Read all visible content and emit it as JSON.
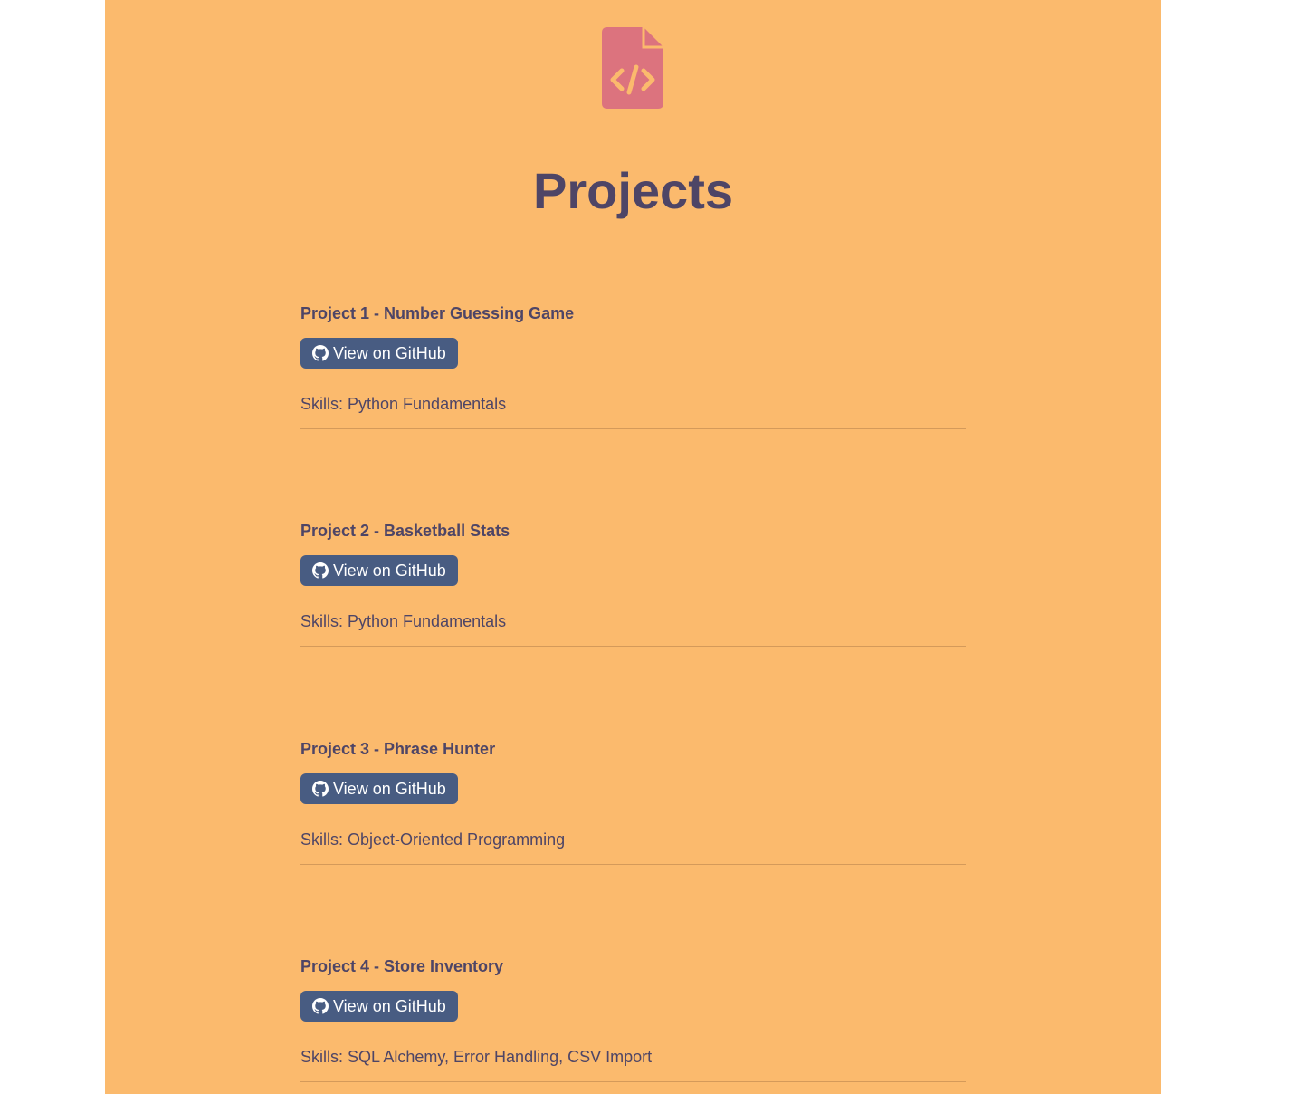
{
  "page": {
    "title": "Projects",
    "logo_icon": "file-code-icon",
    "colors": {
      "background": "#fbba6d",
      "heading": "#4e4566",
      "button": "#485c82",
      "logo": "#dc737e"
    }
  },
  "projects": [
    {
      "title": "Project 1 - Number Guessing Game",
      "button_label": "View on GitHub",
      "button_icon": "github-icon",
      "skills": "Skills: Python Fundamentals"
    },
    {
      "title": "Project 2 - Basketball Stats",
      "button_label": "View on GitHub",
      "button_icon": "github-icon",
      "skills": "Skills: Python Fundamentals"
    },
    {
      "title": "Project 3 - Phrase Hunter",
      "button_label": "View on GitHub",
      "button_icon": "github-icon",
      "skills": "Skills: Object-Oriented Programming"
    },
    {
      "title": "Project 4 - Store Inventory",
      "button_label": "View on GitHub",
      "button_icon": "github-icon",
      "skills": "Skills: SQL Alchemy, Error Handling, CSV Import"
    }
  ]
}
